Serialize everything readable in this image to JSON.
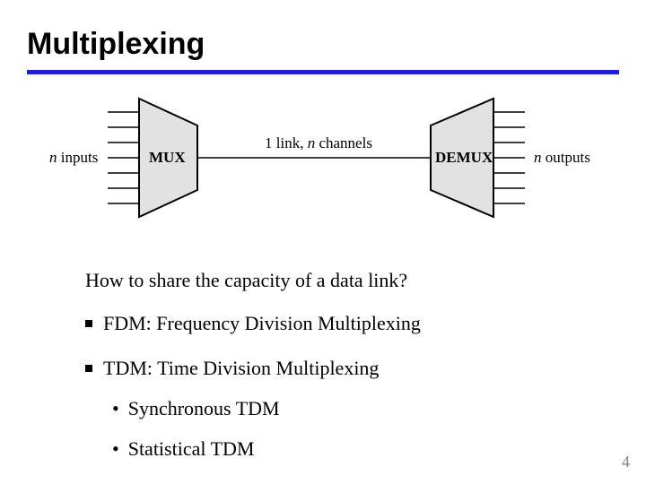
{
  "title": "Multiplexing",
  "diagram": {
    "left_label_pre_n": "",
    "left_label_n": "n",
    "left_label_post": " inputs",
    "mux": "MUX",
    "link_label_pre": "1 link, ",
    "link_label_n": "n",
    "link_label_post": " channels",
    "demux": "DEMUX",
    "right_label_n": "n",
    "right_label_post": " outputs",
    "io_lines": 7
  },
  "question": "How to share the capacity of a data link?",
  "bullets": [
    "FDM: Frequency Division Multiplexing",
    "TDM: Time Division Multiplexing"
  ],
  "subbullets": [
    "Synchronous TDM",
    "Statistical TDM"
  ],
  "page_number": "4"
}
